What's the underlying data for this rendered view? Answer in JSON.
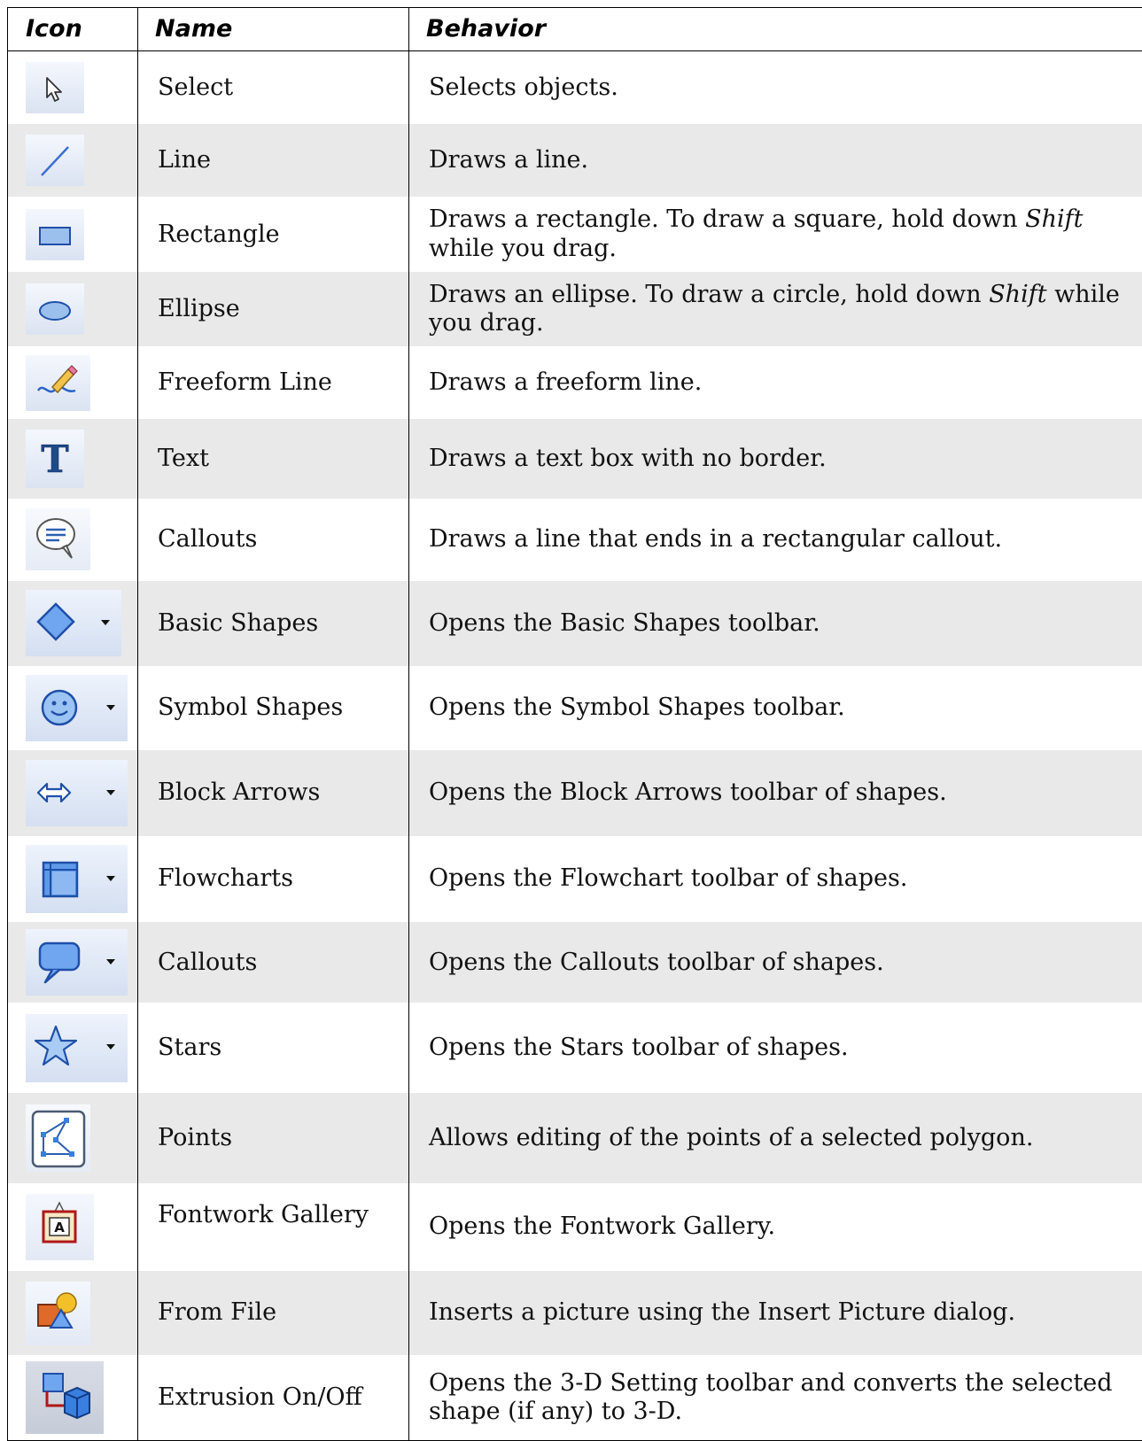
{
  "headers": {
    "icon": "Icon",
    "name": "Name",
    "behavior": "Behavior"
  },
  "rows": [
    {
      "icon": "select-arrow-icon",
      "name": "Select",
      "behavior": "Selects objects."
    },
    {
      "icon": "line-icon",
      "name": "Line",
      "behavior": "Draws a line."
    },
    {
      "icon": "rectangle-icon",
      "name": "Rectangle",
      "behavior_before": "Draws a rectangle. To draw a square, hold down ",
      "behavior_em": "Shift",
      "behavior_after": " while you drag."
    },
    {
      "icon": "ellipse-icon",
      "name": "Ellipse",
      "behavior_before": "Draws an ellipse. To draw a circle, hold down ",
      "behavior_em": "Shift",
      "behavior_after": " while you drag."
    },
    {
      "icon": "freeform-pencil-icon",
      "name": "Freeform Line",
      "behavior": "Draws a freeform line."
    },
    {
      "icon": "text-t-icon",
      "name": "Text",
      "behavior": "Draws a text box with no border."
    },
    {
      "icon": "callout-bubble-icon",
      "name": "Callouts",
      "behavior": "Draws a line that ends in a rectangular callout."
    },
    {
      "icon": "basic-shapes-diamond-icon",
      "name": "Basic Shapes",
      "behavior": "Opens the Basic Shapes toolbar."
    },
    {
      "icon": "symbol-shapes-smiley-icon",
      "name": "Symbol Shapes",
      "behavior": "Opens the Symbol Shapes toolbar."
    },
    {
      "icon": "block-arrows-icon",
      "name": "Block Arrows",
      "behavior": "Opens the Block Arrows toolbar of shapes."
    },
    {
      "icon": "flowcharts-icon",
      "name": "Flowcharts",
      "behavior": "Opens the Flowchart toolbar of shapes."
    },
    {
      "icon": "callouts-speech-icon",
      "name": "Callouts",
      "behavior": "Opens the Callouts toolbar of shapes."
    },
    {
      "icon": "stars-icon",
      "name": "Stars",
      "behavior": "Opens the Stars toolbar of shapes."
    },
    {
      "icon": "points-polygon-icon",
      "name": "Points",
      "behavior": "Allows editing of the points of a selected polygon."
    },
    {
      "icon": "fontwork-gallery-icon",
      "name": "Fontwork Gallery",
      "behavior": "Opens the Fontwork Gallery."
    },
    {
      "icon": "from-file-picture-icon",
      "name": "From File",
      "behavior": "Inserts a picture using the Insert Picture dialog."
    },
    {
      "icon": "extrusion-3d-icon",
      "name": "Extrusion On/Off",
      "behavior": "Opens the 3-D Setting toolbar and converts the selected shape (if any) to 3-D."
    }
  ]
}
